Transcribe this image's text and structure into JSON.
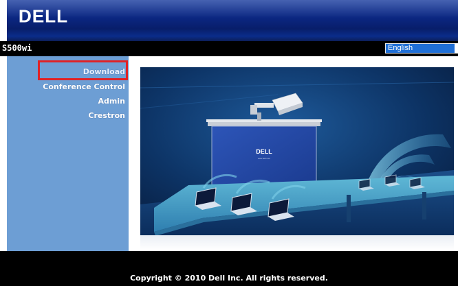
{
  "header": {
    "brand": "DELL"
  },
  "titlebar": {
    "model": "S500wi",
    "language": "English"
  },
  "sidebar": {
    "items": [
      {
        "label": "Download"
      },
      {
        "label": "Conference Control"
      },
      {
        "label": "Admin"
      },
      {
        "label": "Crestron"
      }
    ]
  },
  "scene": {
    "screen_logo": "DELL",
    "screen_url": "www.dell.com"
  },
  "footer": {
    "copyright": "Copyright © 2010 Dell Inc. All rights reserved."
  },
  "colors": {
    "header_blue": "#0b2680",
    "sidebar_blue": "#6d9ed4",
    "highlight_red": "#e02226",
    "select_blue": "#1f6fd6"
  }
}
